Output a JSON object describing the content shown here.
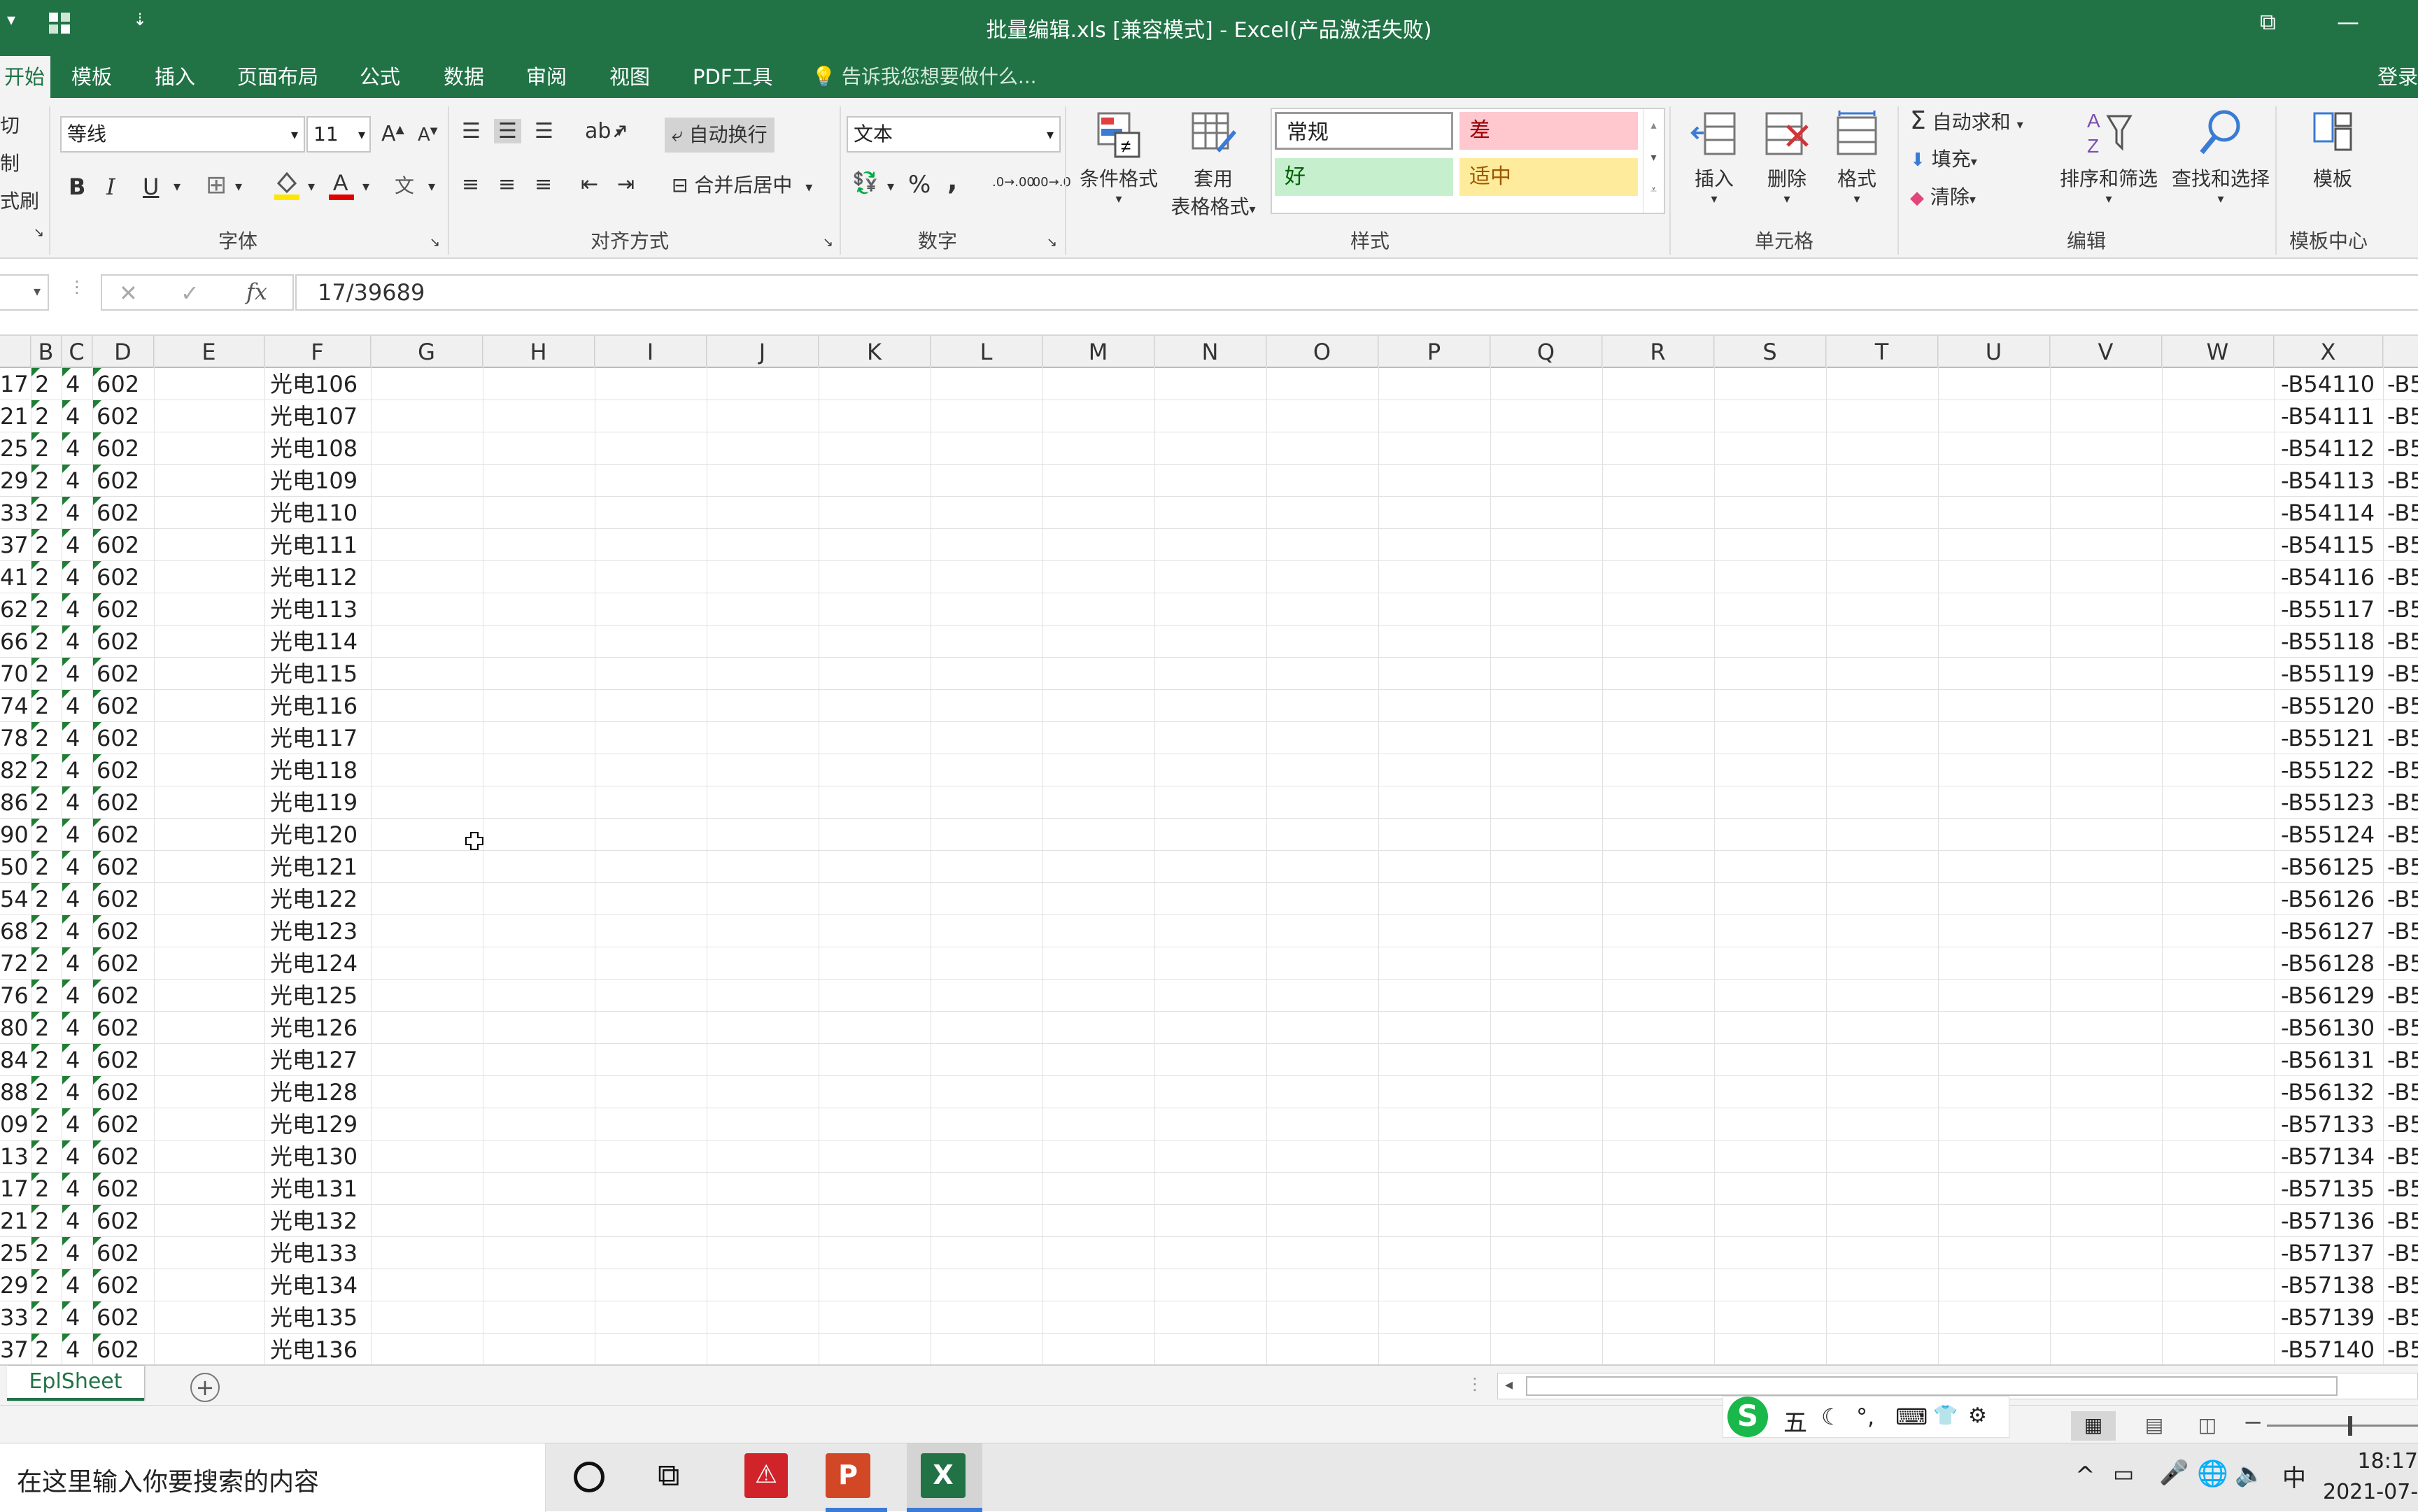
{
  "titlebar": {
    "title": "批量编辑.xls  [兼容模式] - Excel(产品激活失败)",
    "qa_icon": "grid-app-icon",
    "qa_more": "⇣",
    "restore": "⧉",
    "minimize": "—"
  },
  "tabs": {
    "items": [
      {
        "label": "开始",
        "active": true
      },
      {
        "label": "模板"
      },
      {
        "label": "插入"
      },
      {
        "label": "页面布局"
      },
      {
        "label": "公式"
      },
      {
        "label": "数据"
      },
      {
        "label": "审阅"
      },
      {
        "label": "视图"
      },
      {
        "label": "PDF工具"
      }
    ],
    "tell_me": "告诉我您想要做什么...",
    "login": "登录"
  },
  "ribbon": {
    "clipboard": {
      "cut": "切",
      "copy": "制",
      "painter": "式刷"
    },
    "font": {
      "name": "等线",
      "size": "11",
      "grow": "A",
      "shrink": "A",
      "bold": "B",
      "italic": "I",
      "underline": "U",
      "label": "字体"
    },
    "align": {
      "wrap": "自动换行",
      "merge": "合并后居中",
      "label": "对齐方式"
    },
    "number": {
      "format": "文本",
      "percent": "%",
      "comma": ",",
      "inc": ".0→.00",
      "dec": ".00→.0",
      "label": "数字"
    },
    "styles": {
      "conditional": "条件格式",
      "table_1": "套用",
      "table_2": "表格格式",
      "normal": "常规",
      "bad": "差",
      "good": "好",
      "neutral": "适中",
      "label": "样式"
    },
    "cells": {
      "insert": "插入",
      "delete": "删除",
      "format": "格式",
      "label": "单元格"
    },
    "editing": {
      "autosum": "自动求和",
      "fill": "填充",
      "clear": "清除",
      "sort": "排序和筛选",
      "find": "查找和选择",
      "label": "编辑"
    },
    "templates": {
      "btn": "模板",
      "label": "模板中心"
    }
  },
  "formula_bar": {
    "cancel": "✕",
    "enter": "✓",
    "fx": "fx",
    "value": "17/39689"
  },
  "columns": [
    "B",
    "C",
    "D",
    "E",
    "F",
    "G",
    "H",
    "I",
    "J",
    "K",
    "L",
    "M",
    "N",
    "O",
    "P",
    "Q",
    "R",
    "S",
    "T",
    "U",
    "V",
    "W",
    "X"
  ],
  "rows": [
    {
      "a": "17",
      "b": "2",
      "c": "4",
      "d": "602",
      "f": "光电106",
      "x": "-B54110",
      "y": "-B5"
    },
    {
      "a": "21",
      "b": "2",
      "c": "4",
      "d": "602",
      "f": "光电107",
      "x": "-B54111",
      "y": "-B5"
    },
    {
      "a": "25",
      "b": "2",
      "c": "4",
      "d": "602",
      "f": "光电108",
      "x": "-B54112",
      "y": "-B5"
    },
    {
      "a": "29",
      "b": "2",
      "c": "4",
      "d": "602",
      "f": "光电109",
      "x": "-B54113",
      "y": "-B5"
    },
    {
      "a": "33",
      "b": "2",
      "c": "4",
      "d": "602",
      "f": "光电110",
      "x": "-B54114",
      "y": "-B5"
    },
    {
      "a": "37",
      "b": "2",
      "c": "4",
      "d": "602",
      "f": "光电111",
      "x": "-B54115",
      "y": "-B5"
    },
    {
      "a": "41",
      "b": "2",
      "c": "4",
      "d": "602",
      "f": "光电112",
      "x": "-B54116",
      "y": "-B5"
    },
    {
      "a": "62",
      "b": "2",
      "c": "4",
      "d": "602",
      "f": "光电113",
      "x": "-B55117",
      "y": "-B5"
    },
    {
      "a": "66",
      "b": "2",
      "c": "4",
      "d": "602",
      "f": "光电114",
      "x": "-B55118",
      "y": "-B5"
    },
    {
      "a": "70",
      "b": "2",
      "c": "4",
      "d": "602",
      "f": "光电115",
      "x": "-B55119",
      "y": "-B5"
    },
    {
      "a": "74",
      "b": "2",
      "c": "4",
      "d": "602",
      "f": "光电116",
      "x": "-B55120",
      "y": "-B5"
    },
    {
      "a": "78",
      "b": "2",
      "c": "4",
      "d": "602",
      "f": "光电117",
      "x": "-B55121",
      "y": "-B5"
    },
    {
      "a": "82",
      "b": "2",
      "c": "4",
      "d": "602",
      "f": "光电118",
      "x": "-B55122",
      "y": "-B5"
    },
    {
      "a": "86",
      "b": "2",
      "c": "4",
      "d": "602",
      "f": "光电119",
      "x": "-B55123",
      "y": "-B5"
    },
    {
      "a": "90",
      "b": "2",
      "c": "4",
      "d": "602",
      "f": "光电120",
      "x": "-B55124",
      "y": "-B5"
    },
    {
      "a": "50",
      "b": "2",
      "c": "4",
      "d": "602",
      "f": "光电121",
      "x": "-B56125",
      "y": "-B5"
    },
    {
      "a": "54",
      "b": "2",
      "c": "4",
      "d": "602",
      "f": "光电122",
      "x": "-B56126",
      "y": "-B5"
    },
    {
      "a": "68",
      "b": "2",
      "c": "4",
      "d": "602",
      "f": "光电123",
      "x": "-B56127",
      "y": "-B5"
    },
    {
      "a": "72",
      "b": "2",
      "c": "4",
      "d": "602",
      "f": "光电124",
      "x": "-B56128",
      "y": "-B5"
    },
    {
      "a": "76",
      "b": "2",
      "c": "4",
      "d": "602",
      "f": "光电125",
      "x": "-B56129",
      "y": "-B5"
    },
    {
      "a": "80",
      "b": "2",
      "c": "4",
      "d": "602",
      "f": "光电126",
      "x": "-B56130",
      "y": "-B5"
    },
    {
      "a": "84",
      "b": "2",
      "c": "4",
      "d": "602",
      "f": "光电127",
      "x": "-B56131",
      "y": "-B5"
    },
    {
      "a": "88",
      "b": "2",
      "c": "4",
      "d": "602",
      "f": "光电128",
      "x": "-B56132",
      "y": "-B5"
    },
    {
      "a": "09",
      "b": "2",
      "c": "4",
      "d": "602",
      "f": "光电129",
      "x": "-B57133",
      "y": "-B5"
    },
    {
      "a": "13",
      "b": "2",
      "c": "4",
      "d": "602",
      "f": "光电130",
      "x": "-B57134",
      "y": "-B5"
    },
    {
      "a": "17",
      "b": "2",
      "c": "4",
      "d": "602",
      "f": "光电131",
      "x": "-B57135",
      "y": "-B5"
    },
    {
      "a": "21",
      "b": "2",
      "c": "4",
      "d": "602",
      "f": "光电132",
      "x": "-B57136",
      "y": "-B5"
    },
    {
      "a": "25",
      "b": "2",
      "c": "4",
      "d": "602",
      "f": "光电133",
      "x": "-B57137",
      "y": "-B5"
    },
    {
      "a": "29",
      "b": "2",
      "c": "4",
      "d": "602",
      "f": "光电134",
      "x": "-B57138",
      "y": "-B5"
    },
    {
      "a": "33",
      "b": "2",
      "c": "4",
      "d": "602",
      "f": "光电135",
      "x": "-B57139",
      "y": "-B5"
    },
    {
      "a": "37",
      "b": "2",
      "c": "4",
      "d": "602",
      "f": "光电136",
      "x": "-B57140",
      "y": "-B5"
    }
  ],
  "sheet": {
    "tab": "EplSheet",
    "add": "+"
  },
  "ime": {
    "logo": "S",
    "items": [
      "五",
      "☾",
      "°,",
      "⌨",
      "👕",
      "⚙"
    ]
  },
  "taskbar": {
    "search": "在这里输入你要搜索的内容",
    "time": "18:17",
    "date": "2021-07-",
    "lang": "中"
  },
  "colors": {
    "excel_green": "#217346",
    "bad": "#ffc7ce",
    "good": "#c6efce",
    "neutral": "#ffeb9c"
  }
}
